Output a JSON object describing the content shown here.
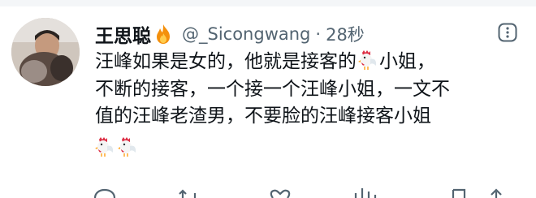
{
  "tweet": {
    "author_name": "王思聪",
    "handle": "@_Sicongwang",
    "separator": "·",
    "timestamp": "28秒",
    "lines": [
      {
        "before": "汪峰如果是女的，他就是接客的",
        "after": "小姐，"
      },
      {
        "text": "不断的接客，一个接一个汪峰小姐，一文不"
      },
      {
        "text": "值的汪峰老渣男，不要脸的汪峰接客小姐"
      }
    ],
    "emoji_names": [
      "rooster-emoji",
      "rooster-emoji"
    ]
  },
  "icons": {
    "name_badge": "fire-icon",
    "inline_emoji": "rooster-icon",
    "more": "more-options-icon",
    "actions": [
      "reply-icon",
      "retweet-icon",
      "like-icon",
      "views-icon",
      "bookmark-icon",
      "share-icon"
    ]
  },
  "colors": {
    "text": "#0f1419",
    "secondary": "#536471",
    "background": "#ffffff"
  }
}
